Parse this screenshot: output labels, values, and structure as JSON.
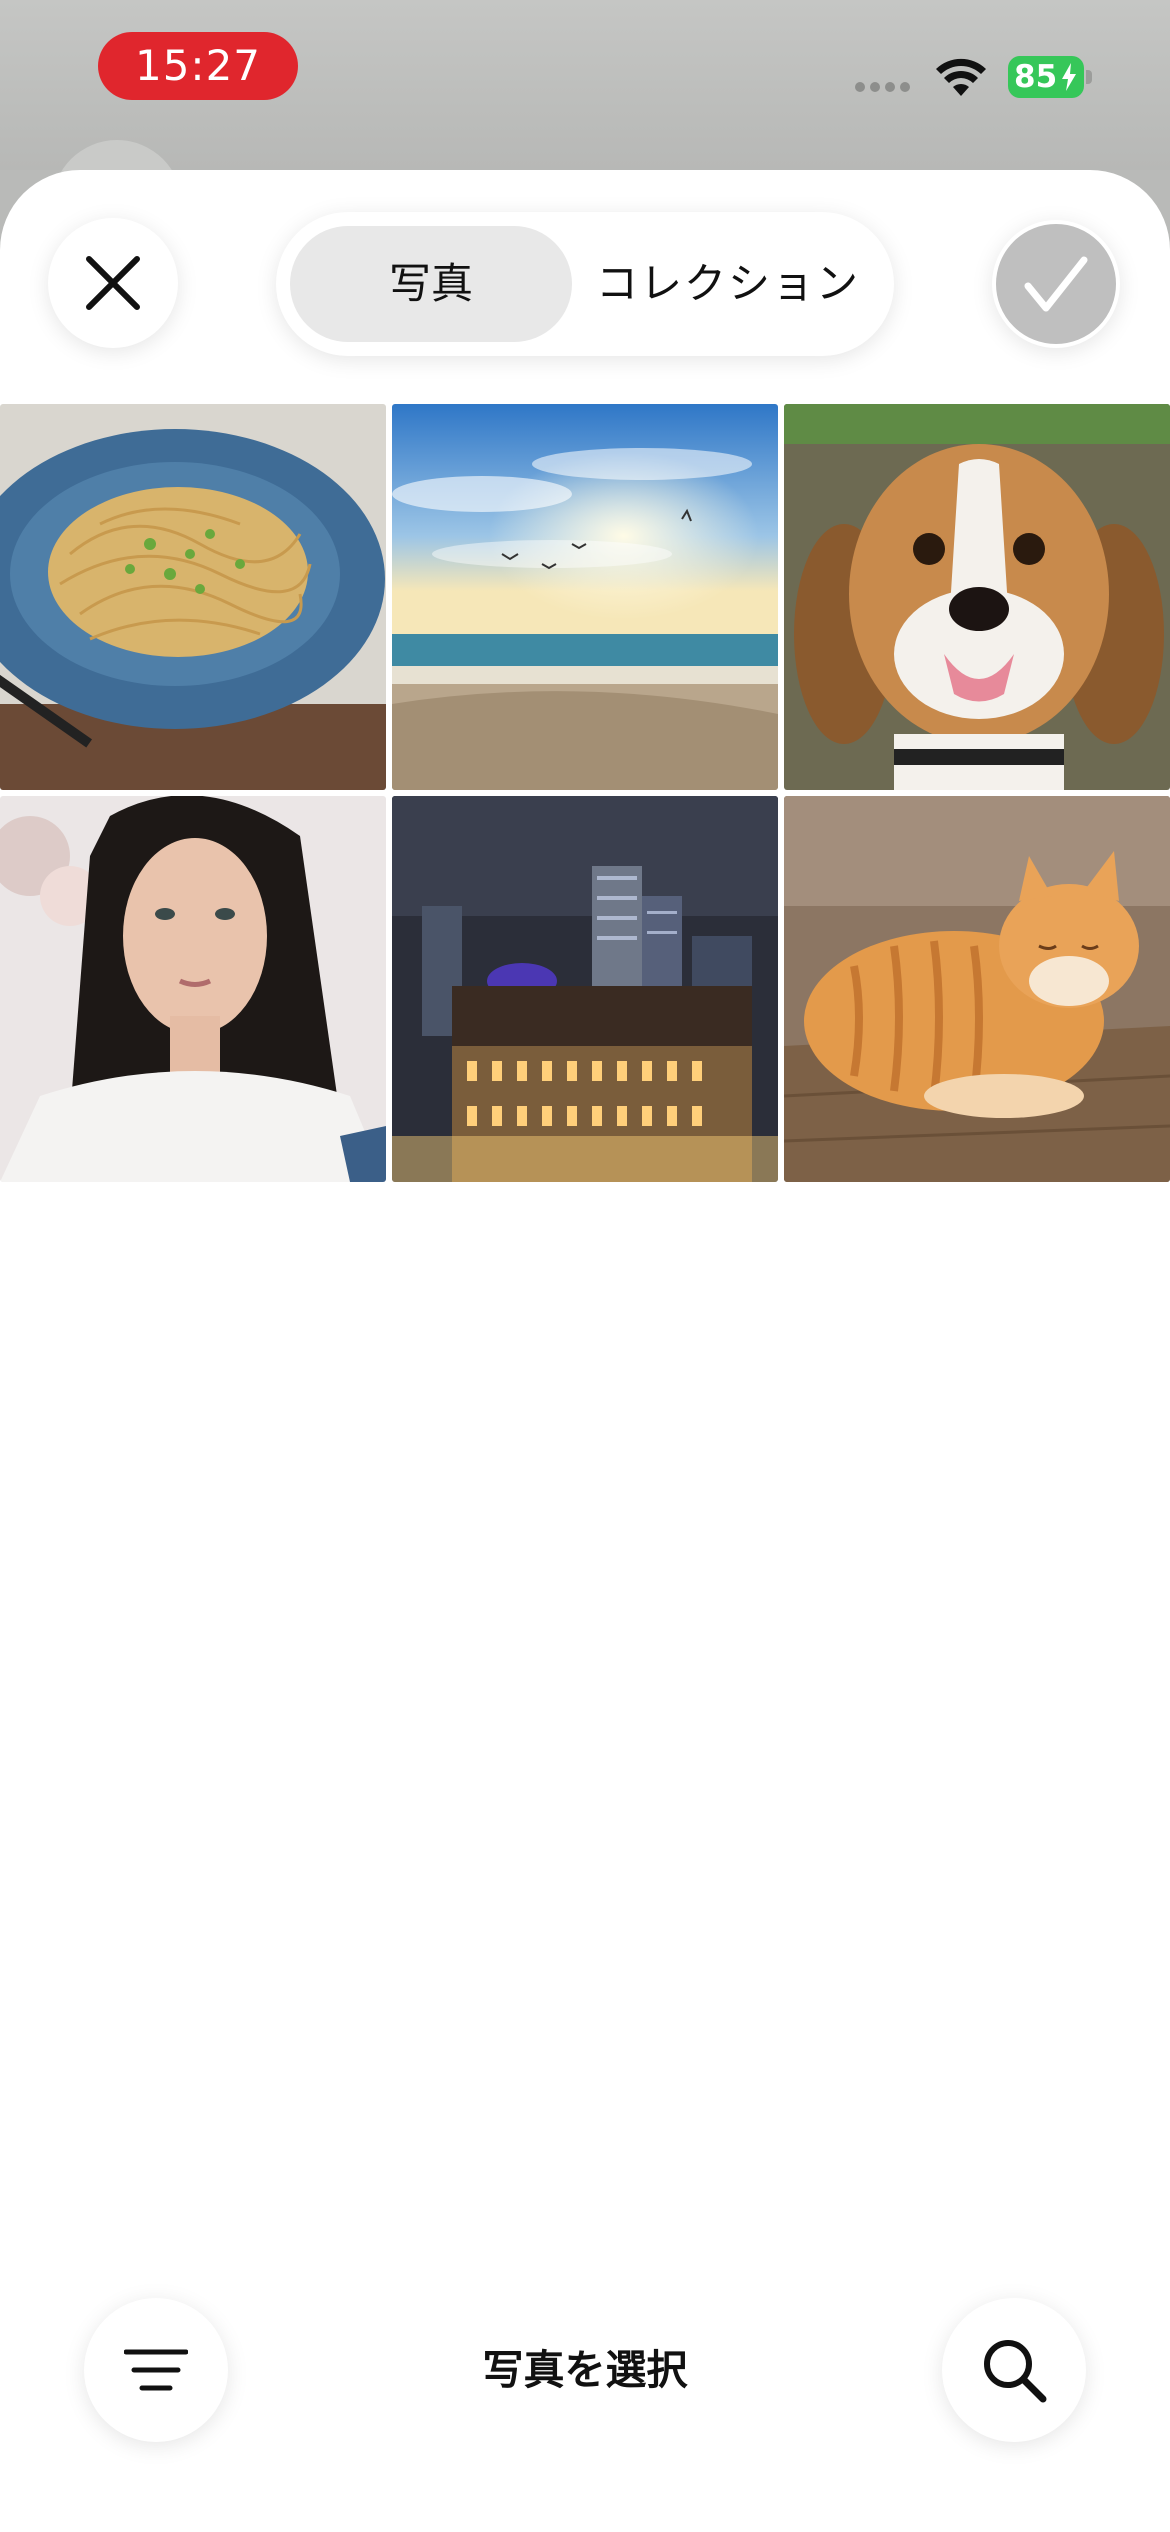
{
  "status_bar": {
    "time": "15:27",
    "battery": "85"
  },
  "header": {
    "tabs": [
      {
        "label": "写真",
        "selected": true
      },
      {
        "label": "コレクション",
        "selected": false
      }
    ]
  },
  "photos": [
    {
      "subject": "pasta-noodles"
    },
    {
      "subject": "beach-sunrise"
    },
    {
      "subject": "beagle-dog"
    },
    {
      "subject": "woman-portrait"
    },
    {
      "subject": "city-night"
    },
    {
      "subject": "orange-cat"
    }
  ],
  "footer": {
    "title": "写真を選択"
  },
  "icons": {
    "close": "close-icon",
    "confirm": "checkmark-icon",
    "filter": "filter-lines-icon",
    "search": "search-icon"
  },
  "colors": {
    "time_pill": "#e0262d",
    "battery": "#36c759",
    "selected_tab": "#e8e8e8",
    "confirm_button": "#bfbfbf"
  }
}
